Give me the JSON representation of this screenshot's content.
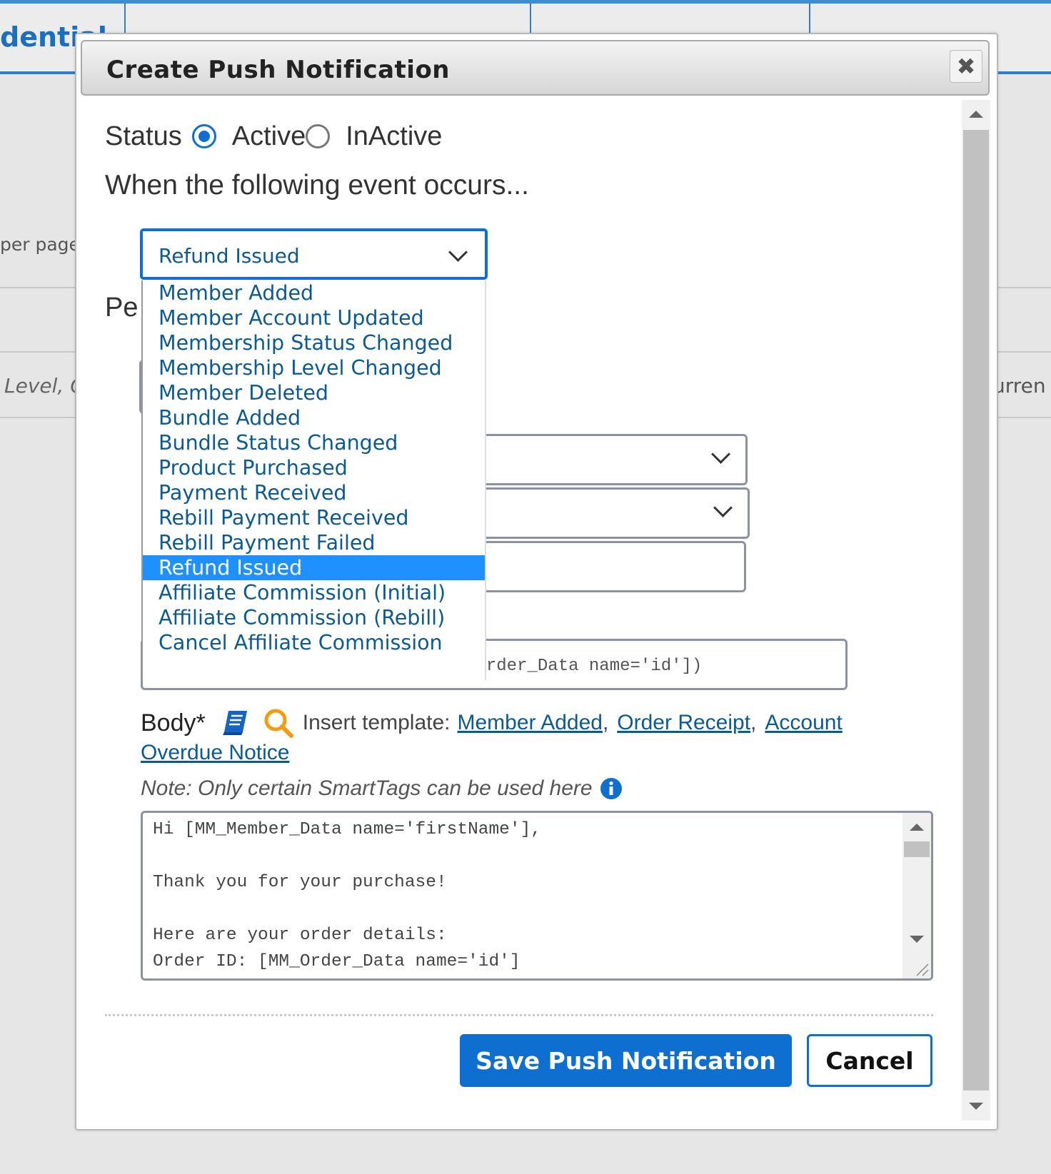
{
  "background": {
    "header_left_text": "dential",
    "per_page_text": "per page",
    "level_text": "Level, C",
    "currency_text": "urren"
  },
  "modal": {
    "title": "Create Push Notification",
    "close_icon": "close-icon"
  },
  "status": {
    "label": "Status",
    "options": [
      {
        "label": "Active",
        "checked": true
      },
      {
        "label": "InActive",
        "checked": false
      }
    ]
  },
  "event": {
    "heading": "When the following event occurs...",
    "selected": "Refund Issued",
    "options": [
      "Member Added",
      "Member Account Updated",
      "Membership Status Changed",
      "Membership Level Changed",
      "Member Deleted",
      "Bundle Added",
      "Bundle Status Changed",
      "Product Purchased",
      "Payment Received",
      "Rebill Payment Received",
      "Rebill Payment Failed",
      "Refund Issued",
      "Affiliate Commission (Initial)",
      "Affiliate Commission (Rebill)",
      "Cancel Affiliate Commission"
    ]
  },
  "partial_section_label": "Pe",
  "subject": {
    "value": "Thank you for your order (#[MM_Order_Data name='id'])"
  },
  "body": {
    "label": "Body*",
    "insert_template_label": "Insert template:",
    "templates": [
      "Member Added",
      "Order Receipt",
      "Account",
      "Overdue Notice"
    ],
    "note": "Note: Only certain SmartTags can be used here",
    "lines": [
      "Hi [MM_Member_Data name='firstName'],",
      "",
      "Thank you for your purchase!",
      "",
      "Here are your order details:",
      "Order ID: [MM_Order_Data name='id']"
    ]
  },
  "buttons": {
    "save": "Save Push Notification",
    "cancel": "Cancel"
  },
  "colors": {
    "accent": "#0f6fd1",
    "link": "#0b5a91",
    "selected_option": "#1e90ff"
  }
}
